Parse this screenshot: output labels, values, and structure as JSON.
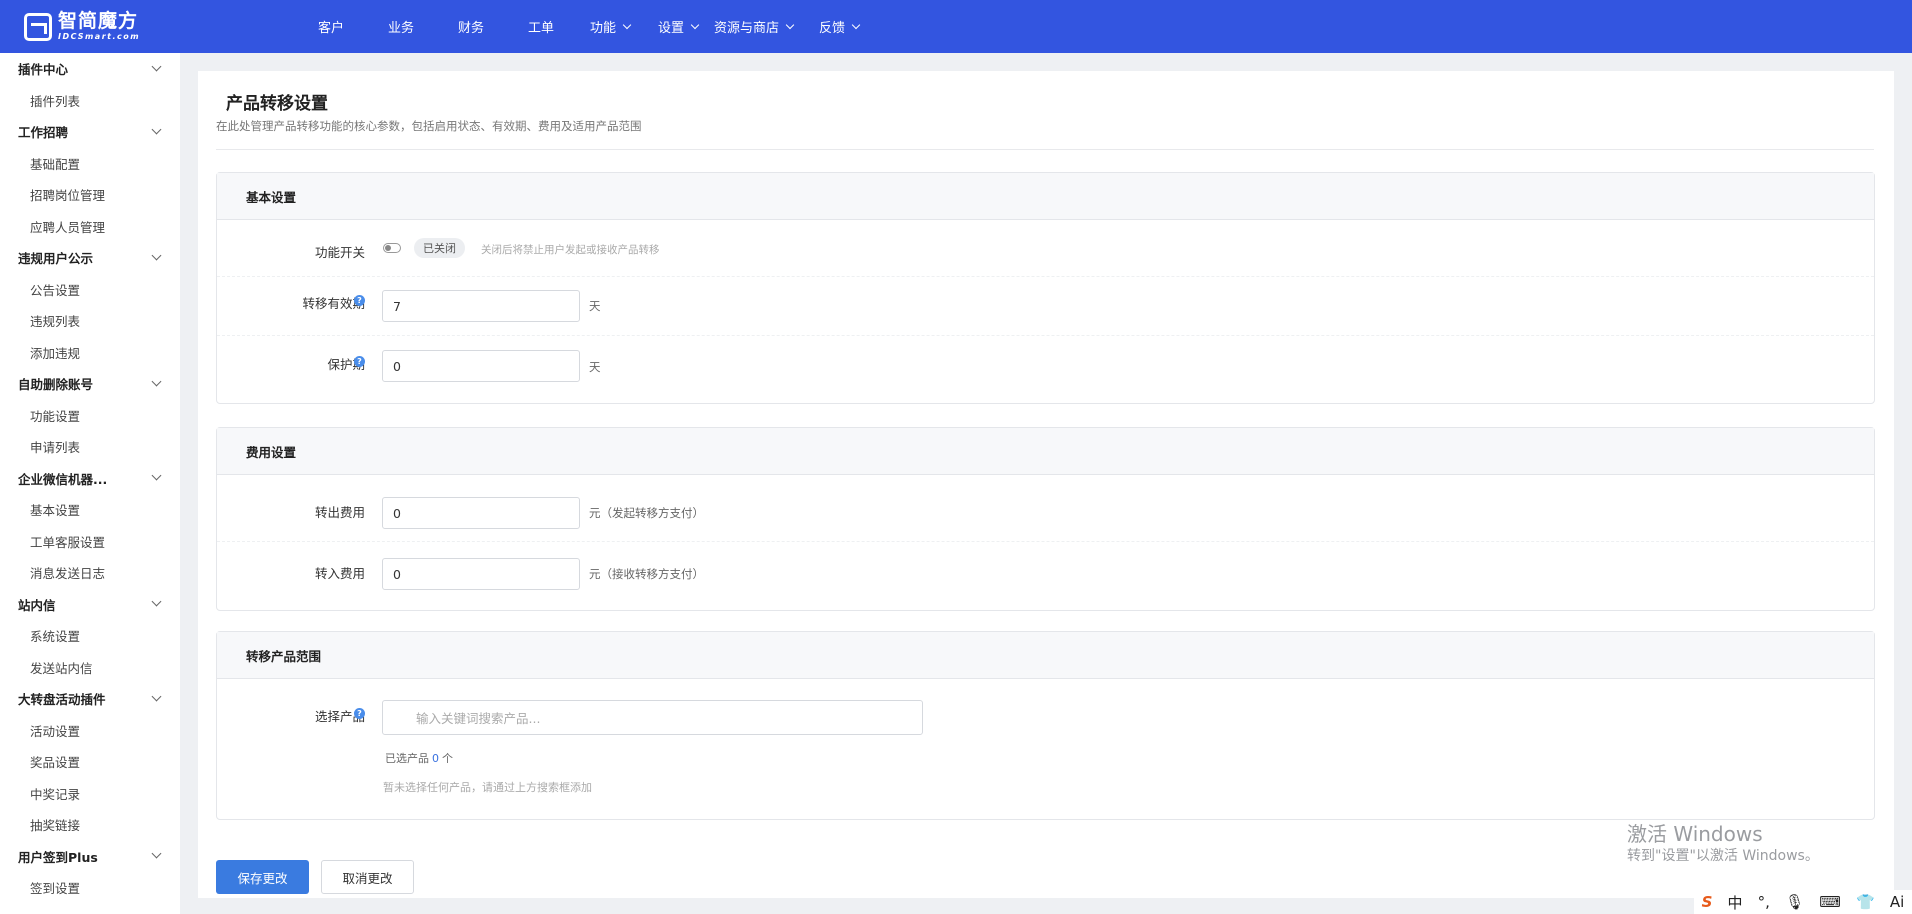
{
  "brand": {
    "name_cn": "智简魔方",
    "name_en": "IDCSmart.com"
  },
  "nav": [
    {
      "label": "客户",
      "dropdown": false
    },
    {
      "label": "业务",
      "dropdown": false
    },
    {
      "label": "财务",
      "dropdown": false
    },
    {
      "label": "工单",
      "dropdown": false
    },
    {
      "label": "功能",
      "dropdown": true
    },
    {
      "label": "设置",
      "dropdown": true
    },
    {
      "label": "资源与商店",
      "dropdown": true
    },
    {
      "label": "反馈",
      "dropdown": true
    }
  ],
  "sidebar": [
    {
      "group": "插件中心",
      "items": [
        "插件列表"
      ]
    },
    {
      "group": "工作招聘",
      "items": [
        "基础配置",
        "招聘岗位管理",
        "应聘人员管理"
      ]
    },
    {
      "group": "违规用户公示",
      "items": [
        "公告设置",
        "违规列表",
        "添加违规"
      ]
    },
    {
      "group": "自助删除账号",
      "items": [
        "功能设置",
        "申请列表"
      ]
    },
    {
      "group": "企业微信机器...",
      "items": [
        "基本设置",
        "工单客服设置",
        "消息发送日志"
      ]
    },
    {
      "group": "站内信",
      "items": [
        "系统设置",
        "发送站内信"
      ]
    },
    {
      "group": "大转盘活动插件",
      "items": [
        "活动设置",
        "奖品设置",
        "中奖记录",
        "抽奖链接"
      ]
    },
    {
      "group": "用户签到Plus",
      "items": [
        "签到设置"
      ]
    }
  ],
  "page": {
    "title": "产品转移设置",
    "description": "在此处管理产品转移功能的核心参数，包括启用状态、有效期、费用及适用产品范围"
  },
  "basic": {
    "title": "基本设置",
    "switch_label": "功能开关",
    "switch_state": "已关闭",
    "switch_hint": "关闭后将禁止用户发起或接收产品转移",
    "validity_label": "转移有效期",
    "validity_value": "7",
    "validity_unit": "天",
    "protect_label": "保护期",
    "protect_value": "0",
    "protect_unit": "天",
    "help_glyph": "?"
  },
  "fee": {
    "title": "费用设置",
    "out_label": "转出费用",
    "out_value": "0",
    "out_unit": "元（发起转移方支付）",
    "in_label": "转入费用",
    "in_value": "0",
    "in_unit": "元（接收转移方支付）"
  },
  "scope": {
    "title": "转移产品范围",
    "select_label": "选择产品",
    "search_placeholder": "输入关键词搜索产品...",
    "selected_prefix": "已选产品",
    "selected_count": "0",
    "selected_suffix": "个",
    "empty_text": "暂未选择任何产品，请通过上方搜索框添加"
  },
  "actions": {
    "save": "保存更改",
    "cancel": "取消更改"
  },
  "watermark": {
    "line1": "激活 Windows",
    "line2": "转到\"设置\"以激活 Windows。"
  },
  "tray": {
    "ime": "中",
    "ai": "Ai"
  },
  "colors": {
    "header": "#3355e0",
    "primary": "#3a7be0",
    "help": "#4a8dea"
  }
}
